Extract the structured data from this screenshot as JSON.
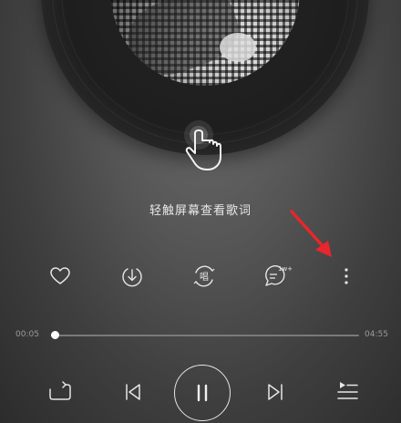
{
  "player": {
    "hint_text": "轻触屏幕查看歌词",
    "current_time": "00:05",
    "total_time": "04:55",
    "progress_fraction": 0.012
  },
  "actions": [
    {
      "name": "like-icon"
    },
    {
      "name": "download-icon"
    },
    {
      "name": "sing-icon",
      "label": "唱"
    },
    {
      "name": "comment-icon",
      "badge": "1w+"
    },
    {
      "name": "more-icon"
    }
  ],
  "controls": [
    {
      "name": "repeat-icon"
    },
    {
      "name": "previous-icon"
    },
    {
      "name": "pause-icon"
    },
    {
      "name": "next-icon"
    },
    {
      "name": "playlist-icon"
    }
  ],
  "colors": {
    "annotation_arrow": "#e8262b",
    "icon": "#e6e6e6"
  }
}
